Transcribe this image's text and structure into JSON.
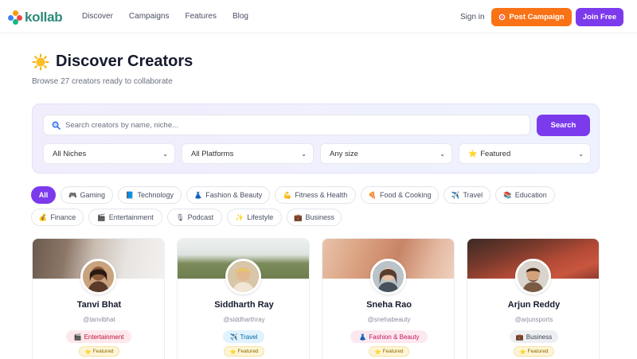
{
  "nav": {
    "brand": "kollab",
    "links": [
      "Discover",
      "Campaigns",
      "Features",
      "Blog"
    ],
    "signin": "Sign in",
    "post_campaign": "Post Campaign",
    "join": "Join Free"
  },
  "header": {
    "title": "Discover Creators",
    "subtitle": "Browse 27 creators ready to collaborate"
  },
  "search": {
    "placeholder": "Search creators by name, niche...",
    "button": "Search",
    "filters": [
      "All Niches",
      "All Platforms",
      "Any size",
      "Featured"
    ]
  },
  "chips": [
    {
      "label": "All",
      "icon": ""
    },
    {
      "label": "Gaming",
      "icon": "🎮"
    },
    {
      "label": "Technology",
      "icon": "📘"
    },
    {
      "label": "Fashion & Beauty",
      "icon": "👗"
    },
    {
      "label": "Fitness & Health",
      "icon": "💪"
    },
    {
      "label": "Food & Cooking",
      "icon": "🍕"
    },
    {
      "label": "Travel",
      "icon": "✈️"
    },
    {
      "label": "Education",
      "icon": "📚"
    },
    {
      "label": "Finance",
      "icon": "💰"
    },
    {
      "label": "Entertainment",
      "icon": "🎬"
    },
    {
      "label": "Podcast",
      "icon": "🎙"
    },
    {
      "label": "Lifestyle",
      "icon": "✨"
    },
    {
      "label": "Business",
      "icon": "💼"
    }
  ],
  "creators": [
    {
      "name": "Tanvi Bhat",
      "handle": "@tanvibhat",
      "niche": "Entertainment",
      "niche_icon": "🎬",
      "badge": "Featured",
      "badge_icon": "⭐"
    },
    {
      "name": "Siddharth Ray",
      "handle": "@siddharthray",
      "niche": "Travel",
      "niche_icon": "✈️",
      "badge": "Featured",
      "badge_icon": "⭐"
    },
    {
      "name": "Sneha Rao",
      "handle": "@snehabeauty",
      "niche": "Fashion & Beauty",
      "niche_icon": "👗",
      "badge": "Featured",
      "badge_icon": "⭐"
    },
    {
      "name": "Arjun Reddy",
      "handle": "@arjunsports",
      "niche": "Business",
      "niche_icon": "💼",
      "badge": "Featured",
      "badge_icon": "⭐"
    }
  ],
  "colors": {
    "accent": "#7c3aed",
    "orange": "#f97316",
    "brand": "#2c8a7a"
  }
}
